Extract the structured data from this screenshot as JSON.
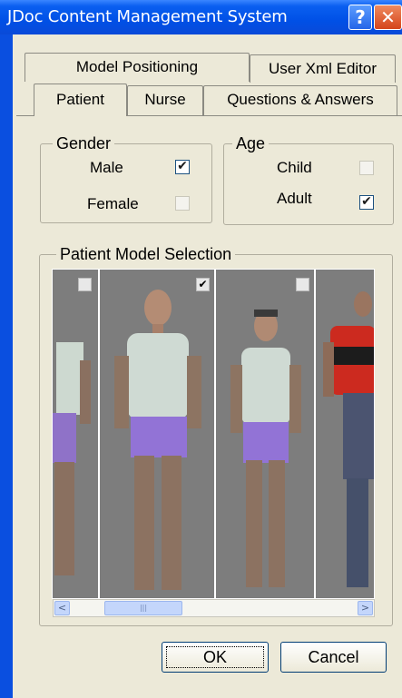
{
  "window": {
    "title": "JDoc Content Management System",
    "help_label": "?",
    "close_label": "✕"
  },
  "tabs": {
    "row1": [
      "Model Positioning",
      "User Xml Editor"
    ],
    "row2": [
      "Patient",
      "Nurse",
      "Questions & Answers"
    ],
    "active": "Patient"
  },
  "gender": {
    "legend": "Gender",
    "options": [
      {
        "label": "Male",
        "checked": true
      },
      {
        "label": "Female",
        "checked": false
      }
    ]
  },
  "age": {
    "legend": "Age",
    "options": [
      {
        "label": "Child",
        "checked": false
      },
      {
        "label": "Adult",
        "checked": true
      }
    ]
  },
  "model_selection": {
    "legend": "Patient Model Selection",
    "models": [
      {
        "checked": false
      },
      {
        "checked": true
      },
      {
        "checked": false
      },
      {
        "checked": false
      }
    ]
  },
  "scrollbar": {
    "left_arrow": "<",
    "right_arrow": ">",
    "thumb_grip": "|||"
  },
  "buttons": {
    "ok": "OK",
    "cancel": "Cancel"
  },
  "check_glyph": "✔"
}
